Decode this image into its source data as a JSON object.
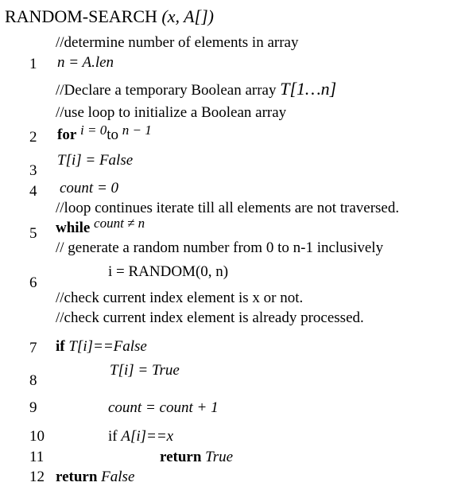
{
  "title": {
    "name": "RANDOM-SEARCH",
    "args": "(x, A[])"
  },
  "lines": {
    "c_determine": "//determine number of elements in array",
    "l1_num": "1",
    "l1_code": "n = A.len",
    "c_declare": "//Declare a temporary Boolean array",
    "c_declare_math": "T[1…n]",
    "c_loop_init": "//use loop to initialize a Boolean array",
    "l2_num": "2",
    "l2_kw": "for",
    "l2_a": "i = 0",
    "l2_to": "to",
    "l2_b": "n − 1",
    "l3_num": "3",
    "l3_code": "T[i] = False",
    "l4_num": "4",
    "l4_code": "count = 0",
    "c_loop_continue": "//loop continues iterate till all elements are not traversed.",
    "l5_num": "5",
    "l5_kw": "while",
    "l5_code": "count ≠ n",
    "c_generate": "// generate a random number from 0 to n-1 inclusively",
    "l6_num": "6",
    "l6_code": "i = RANDOM(0, n)",
    "c_check_x": "//check current index element is x or not.",
    "c_check_processed": "//check current index element is already processed.",
    "l7_num": "7",
    "l7_kw": "if",
    "l7_code": "T[i]==False",
    "l8_num": "8",
    "l8_code": "T[i] = True",
    "l9_num": "9",
    "l9_code": "count = count + 1",
    "l10_num": "10",
    "l10_kw": "if",
    "l10_code": "A[i]==x",
    "l11_num": "11",
    "l11_kw": "return",
    "l11_val": "True",
    "l12_num": "12",
    "l12_kw": "return",
    "l12_val": "False"
  }
}
